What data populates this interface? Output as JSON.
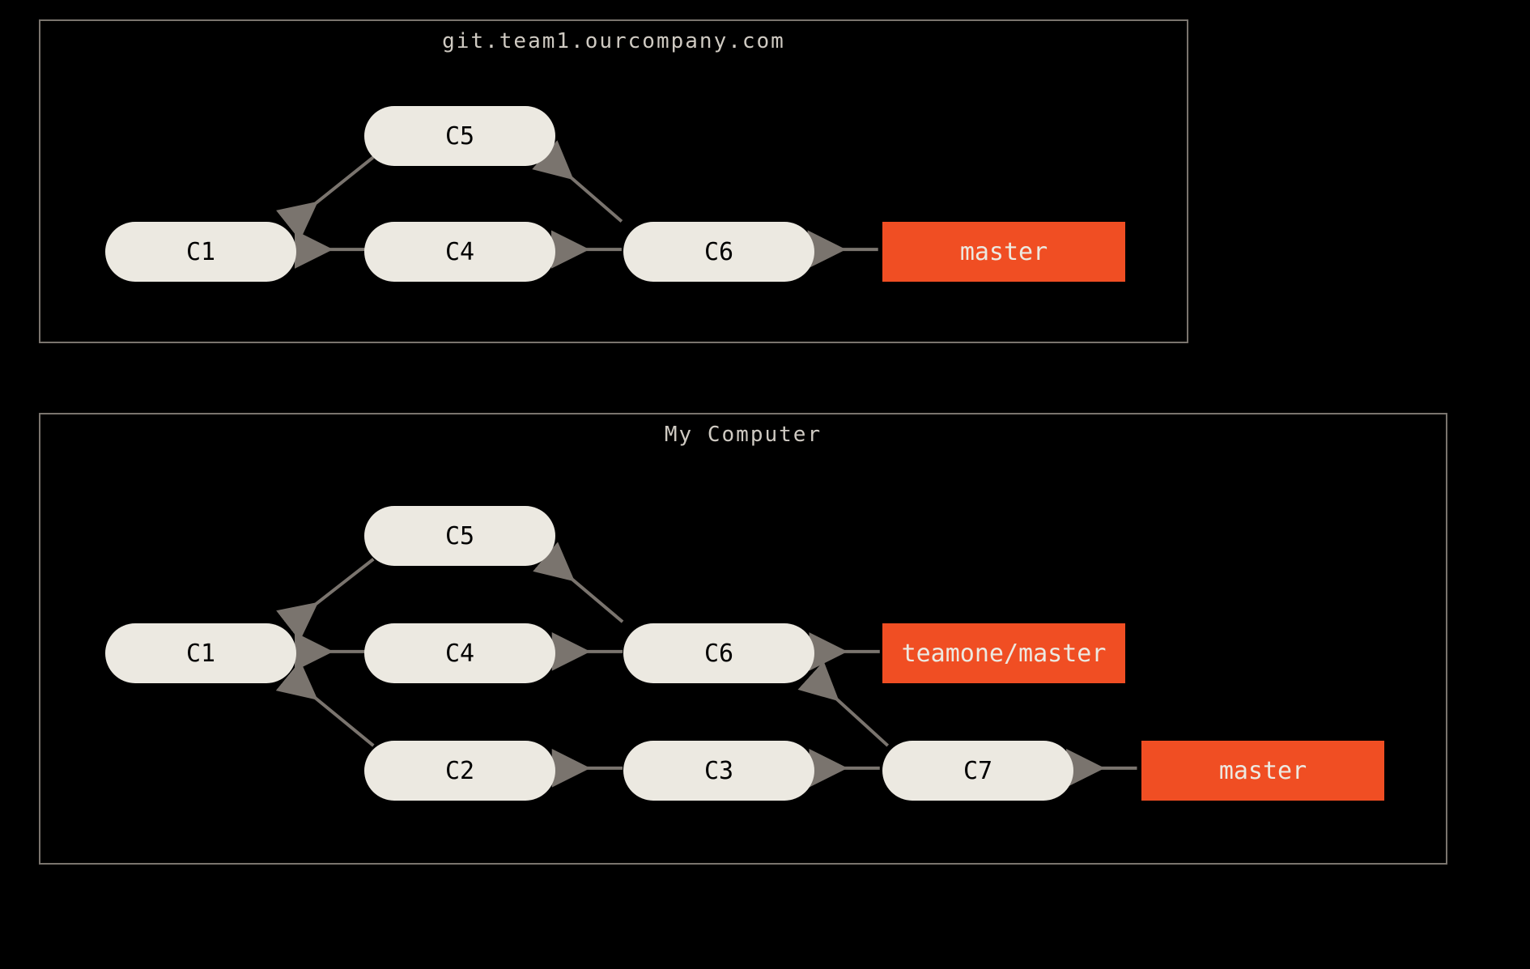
{
  "panels": {
    "remote": {
      "title": "git.team1.ourcompany.com",
      "commits": {
        "c1": "C1",
        "c4": "C4",
        "c5": "C5",
        "c6": "C6"
      },
      "branches": {
        "master": "master"
      }
    },
    "local": {
      "title": "My Computer",
      "commits": {
        "c1": "C1",
        "c2": "C2",
        "c3": "C3",
        "c4": "C4",
        "c5": "C5",
        "c6": "C6",
        "c7": "C7"
      },
      "branches": {
        "teamone_master": "teamone/master",
        "master": "master"
      }
    }
  },
  "arrow_color": "#7a746e"
}
